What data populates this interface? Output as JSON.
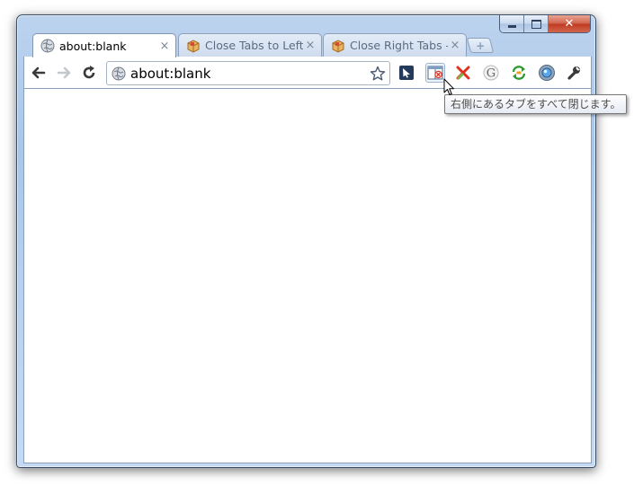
{
  "window": {
    "caption_buttons": {
      "minimize_icon": "minimize-icon",
      "maximize_icon": "maximize-icon",
      "close_glyph": "✕"
    }
  },
  "tabs": [
    {
      "title": "about:blank",
      "icon": "globe-icon",
      "close": "×",
      "active": true
    },
    {
      "title": "Close Tabs to Left",
      "icon": "extension-cube-icon",
      "close": "×",
      "active": false
    },
    {
      "title": "Close Right Tabs -",
      "icon": "extension-cube-icon",
      "close": "×",
      "active": false
    }
  ],
  "new_tab": {
    "glyph": "+",
    "icon": "new-tab-icon"
  },
  "toolbar": {
    "back_icon": "back-arrow-icon",
    "forward_icon": "forward-arrow-icon",
    "reload_icon": "reload-icon",
    "address": {
      "value": "about:blank",
      "icon": "globe-icon",
      "bookmark_icon": "star-icon"
    },
    "extensions": [
      {
        "icon": "cursor-arrow-icon"
      },
      {
        "icon": "close-right-tabs-icon"
      },
      {
        "icon": "red-x-icon"
      },
      {
        "icon": "google-g-icon"
      },
      {
        "icon": "sync-arrows-icon"
      },
      {
        "icon": "orb-icon"
      }
    ],
    "wrench_icon": "wrench-icon"
  },
  "tooltip": {
    "text": "右側にあるタブをすべて閉じます。"
  }
}
